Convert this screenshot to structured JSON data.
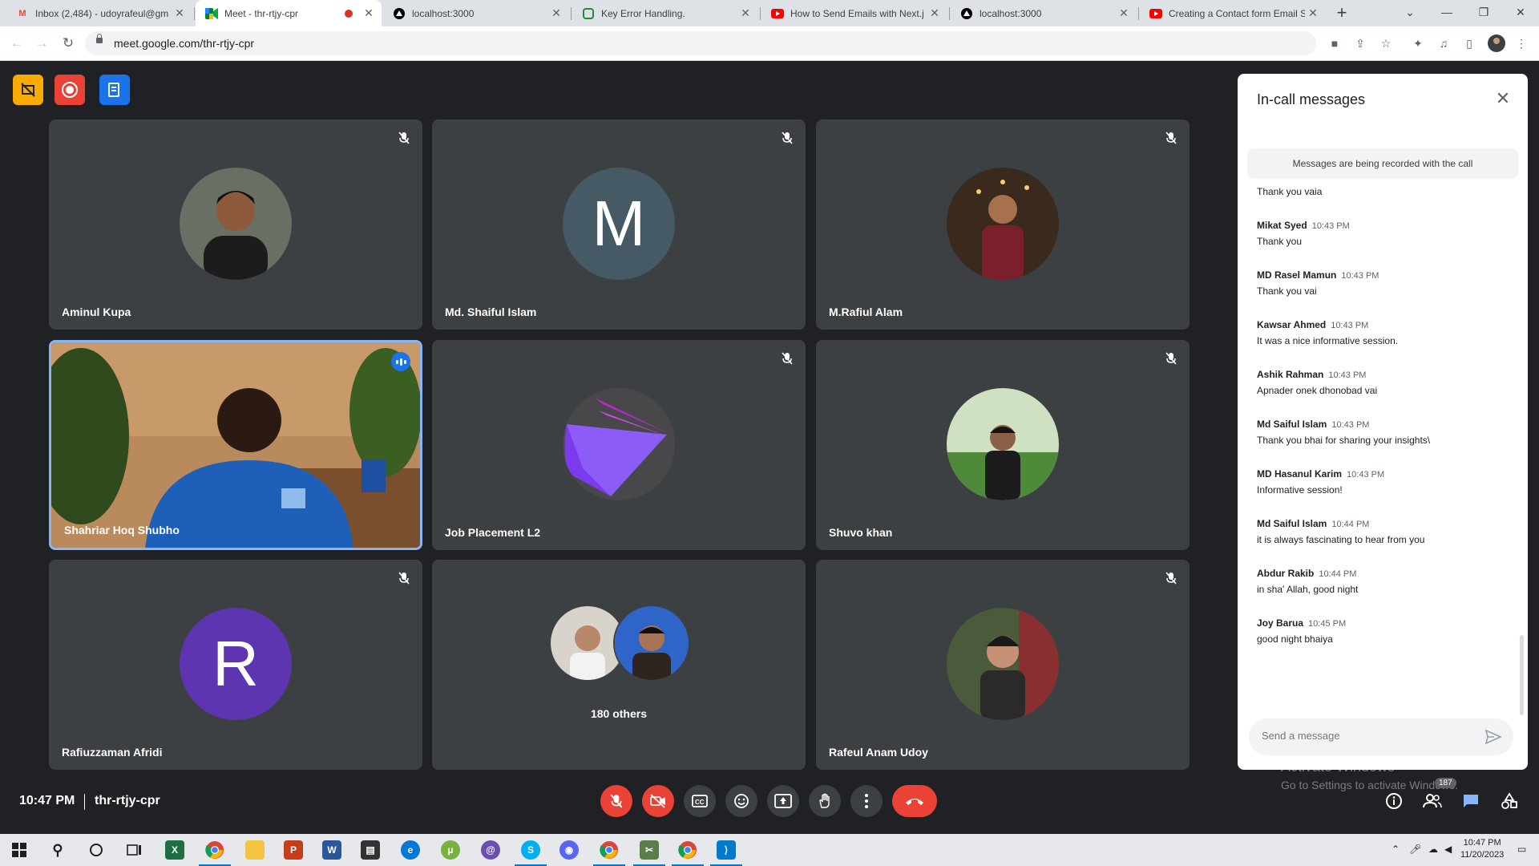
{
  "browser": {
    "tabs": [
      {
        "title": "Inbox (2,484) - udoyrafeul@gm",
        "favicon": "gmail-icon",
        "active": false
      },
      {
        "title": "Meet - thr-rtjy-cpr",
        "favicon": "meet-icon",
        "active": true,
        "recording": true
      },
      {
        "title": "localhost:3000",
        "favicon": "vercel-icon",
        "active": false
      },
      {
        "title": "Key Error Handling.",
        "favicon": "page-icon",
        "active": false
      },
      {
        "title": "How to Send Emails with Next.j",
        "favicon": "youtube-icon",
        "active": false
      },
      {
        "title": "localhost:3000",
        "favicon": "vercel-icon",
        "active": false
      },
      {
        "title": "Creating a Contact form Email S",
        "favicon": "youtube-icon",
        "active": false
      }
    ],
    "url": "meet.google.com/thr-rtjy-cpr"
  },
  "meet": {
    "participants": [
      {
        "name": "Aminul Kupa",
        "muted": true,
        "avatar": "photo"
      },
      {
        "name": "Md. Shaiful Islam",
        "muted": true,
        "avatar": "letter",
        "letter": "M",
        "color": "#455a64"
      },
      {
        "name": "M.Rafiul Alam",
        "muted": true,
        "avatar": "photo"
      },
      {
        "name": "Shahriar Hoq Shubho",
        "muted": false,
        "speaking": true,
        "avatar": "video"
      },
      {
        "name": "Job Placement L2",
        "muted": true,
        "avatar": "logo"
      },
      {
        "name": "Shuvo khan",
        "muted": true,
        "avatar": "photo"
      },
      {
        "name": "Rafiuzzaman Afridi",
        "muted": true,
        "avatar": "letter",
        "letter": "R",
        "color": "#5e35b1"
      },
      {
        "name": "Rafeul Anam Udoy",
        "muted": true,
        "avatar": "photo"
      }
    ],
    "others_label": "180 others",
    "time": "10:47 PM",
    "meeting_code": "thr-rtjy-cpr",
    "people_count": "187",
    "controls": [
      "mic-off-icon",
      "camera-off-icon",
      "captions-icon",
      "emoji-icon",
      "present-icon",
      "raise-hand-icon",
      "more-options-icon",
      "end-call-icon"
    ]
  },
  "chat": {
    "title": "In-call messages",
    "notice": "Messages are being recorded with the call",
    "messages": [
      {
        "sender": "",
        "time": "",
        "text": "Thank you vaia"
      },
      {
        "sender": "Mikat Syed",
        "time": "10:43 PM",
        "text": "Thank you"
      },
      {
        "sender": "MD Rasel Mamun",
        "time": "10:43 PM",
        "text": "Thank you vai"
      },
      {
        "sender": "Kawsar Ahmed",
        "time": "10:43 PM",
        "text": "It was a nice informative session."
      },
      {
        "sender": "Ashik Rahman",
        "time": "10:43 PM",
        "text": "Apnader onek dhonobad vai"
      },
      {
        "sender": "Md Saiful Islam",
        "time": "10:43 PM",
        "text": "Thank you  bhai for sharing your insights\\"
      },
      {
        "sender": "MD Hasanul Karim",
        "time": "10:43 PM",
        "text": "Informative session!"
      },
      {
        "sender": "Md Saiful Islam",
        "time": "10:44 PM",
        "text": "it is always fascinating to hear from you"
      },
      {
        "sender": "Abdur Rakib",
        "time": "10:44 PM",
        "text": "in sha' Allah, good night"
      },
      {
        "sender": "Joy Barua",
        "time": "10:45 PM",
        "text": "good night bhaiya"
      }
    ],
    "input_placeholder": "Send a message"
  },
  "watermark": {
    "line1": "Activate Windows",
    "line2": "Go to Settings to activate Windows."
  },
  "taskbar": {
    "time": "10:47 PM",
    "date": "11/20/2023"
  }
}
